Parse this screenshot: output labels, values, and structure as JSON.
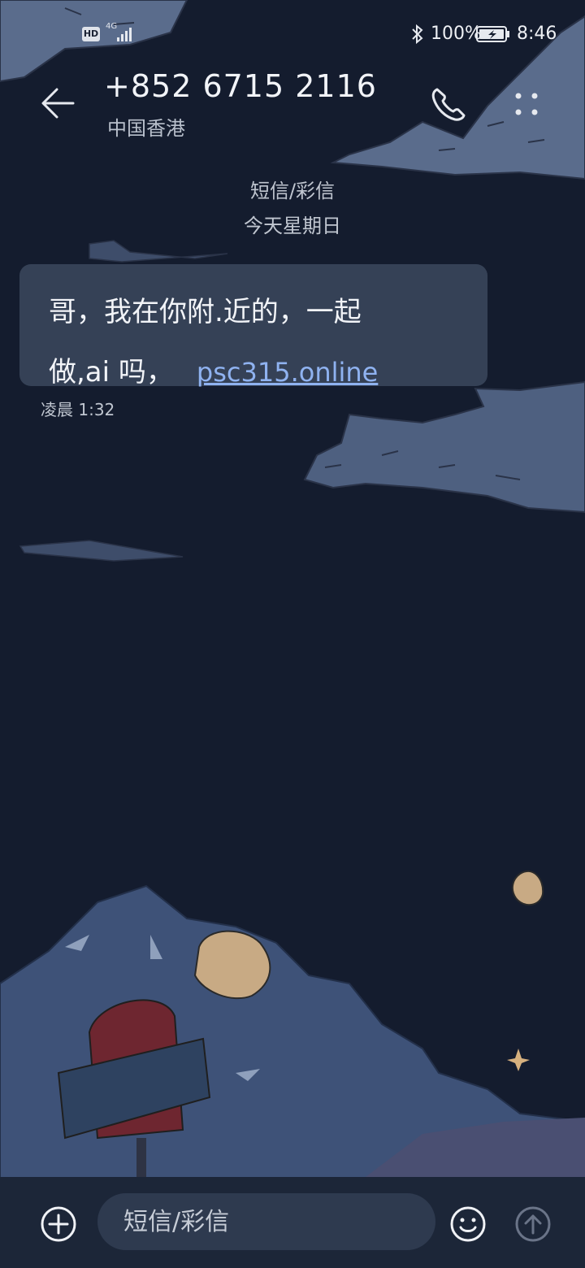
{
  "status_bar": {
    "hd": "HD",
    "network": "4G",
    "battery_pct": "100%",
    "time": "8:46"
  },
  "header": {
    "contact_number": "+852 6715 2116",
    "contact_region": "中国香港"
  },
  "thread": {
    "channel_label": "短信/彩信",
    "date_label": "今天星期日"
  },
  "messages": [
    {
      "line1": "哥，我在你附.近的，一起",
      "line2": "做,ai 吗，",
      "link": "psc315.online",
      "time": "凌晨 1:32"
    }
  ],
  "composer": {
    "placeholder": "短信/彩信"
  },
  "colors": {
    "background": "#141c2e",
    "bubble": "#4a5870",
    "link": "#8fb2f0",
    "composer_bar": "#1c2638",
    "input": "#2e3a4f"
  }
}
